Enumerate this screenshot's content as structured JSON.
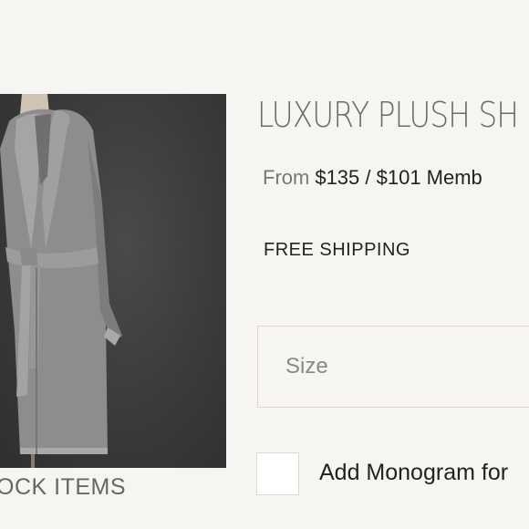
{
  "product": {
    "title": "LUXURY PLUSH SH",
    "price_prefix": "From",
    "price_values": "$135 / $101 Memb",
    "shipping": "FREE SHIPPING",
    "image_caption": "OCK ITEMS",
    "image_subject": "gray plush robe on dress form"
  },
  "options": {
    "size_placeholder": "Size",
    "monogram_label": "Add Monogram for"
  }
}
